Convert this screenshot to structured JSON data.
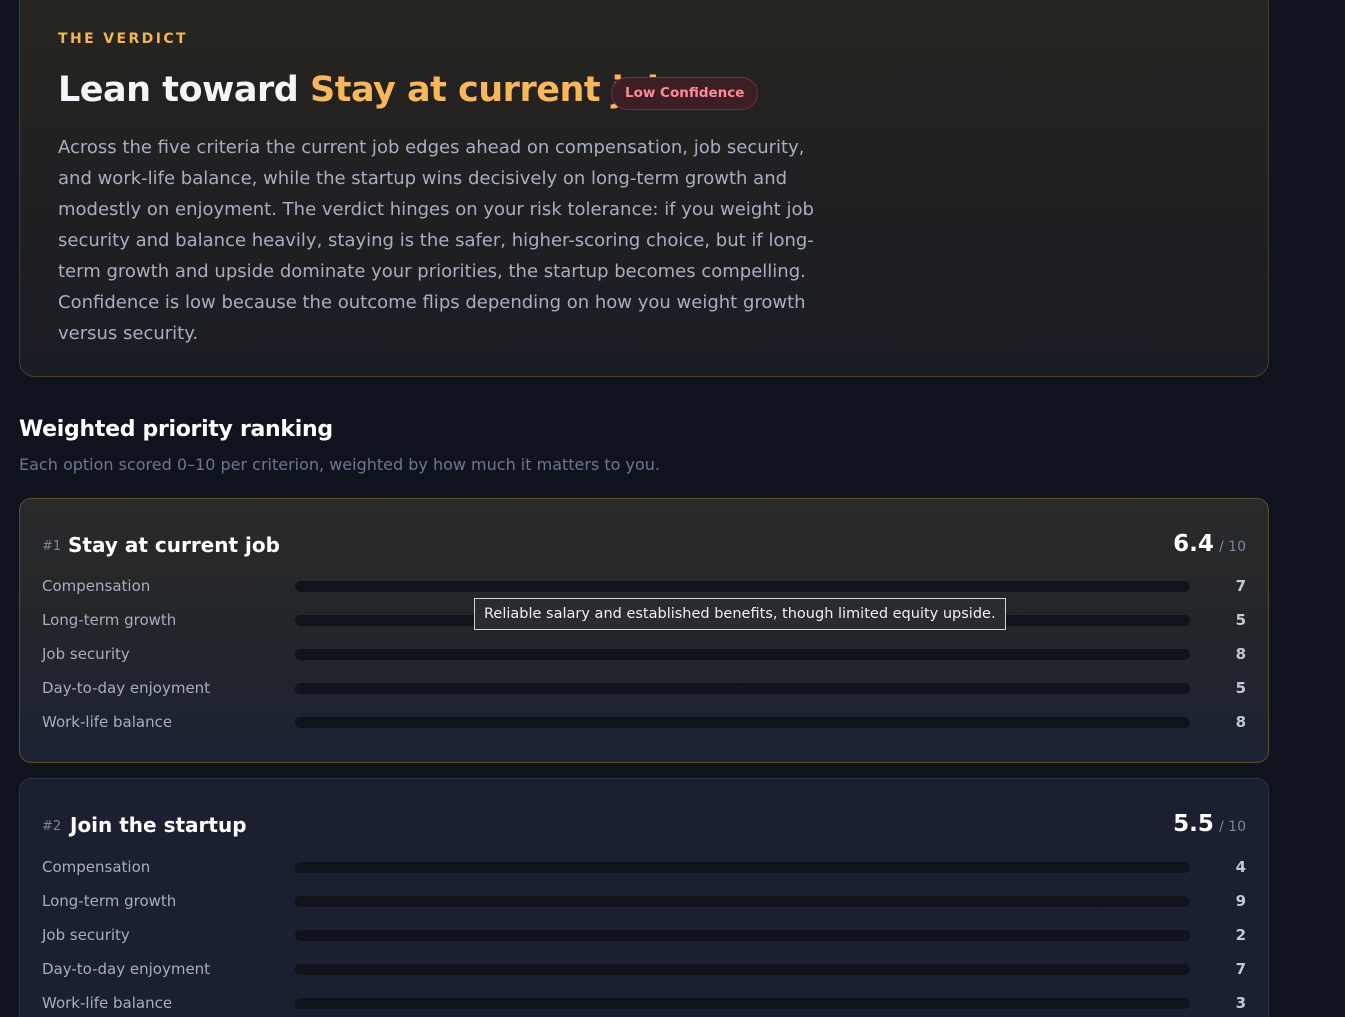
{
  "verdict": {
    "eyebrow": "THE VERDICT",
    "headline_prefix": "Lean toward ",
    "headline_choice": "Stay at current job",
    "confidence": "Low Confidence",
    "summary": "Across the five criteria the current job edges ahead on compensation, job security, and work-life balance, while the startup wins decisively on long-term growth and modestly on enjoyment. The verdict hinges on your risk tolerance: if you weight job security and balance heavily, staying is the safer, higher-scoring choice, but if long-term growth and upside dominate your priorities, the startup becomes compelling. Confidence is low because the outcome flips depending on how you weight growth versus security."
  },
  "ranking": {
    "title": "Weighted priority ranking",
    "subtitle": "Each option scored 0–10 per criterion, weighted by how much it matters to you.",
    "score_denominator": "/ 10",
    "options": [
      {
        "rank": "#1",
        "name": "Stay at current job",
        "score": "6.4",
        "criteria": [
          {
            "label": "Compensation",
            "value": "7"
          },
          {
            "label": "Long-term growth",
            "value": "5"
          },
          {
            "label": "Job security",
            "value": "8"
          },
          {
            "label": "Day-to-day enjoyment",
            "value": "5"
          },
          {
            "label": "Work-life balance",
            "value": "8"
          }
        ]
      },
      {
        "rank": "#2",
        "name": "Join the startup",
        "score": "5.5",
        "criteria": [
          {
            "label": "Compensation",
            "value": "4"
          },
          {
            "label": "Long-term growth",
            "value": "9"
          },
          {
            "label": "Job security",
            "value": "2"
          },
          {
            "label": "Day-to-day enjoyment",
            "value": "7"
          },
          {
            "label": "Work-life balance",
            "value": "3"
          }
        ]
      }
    ]
  },
  "tooltip": {
    "text": "Reliable salary and established benefits, though limited equity upside."
  }
}
